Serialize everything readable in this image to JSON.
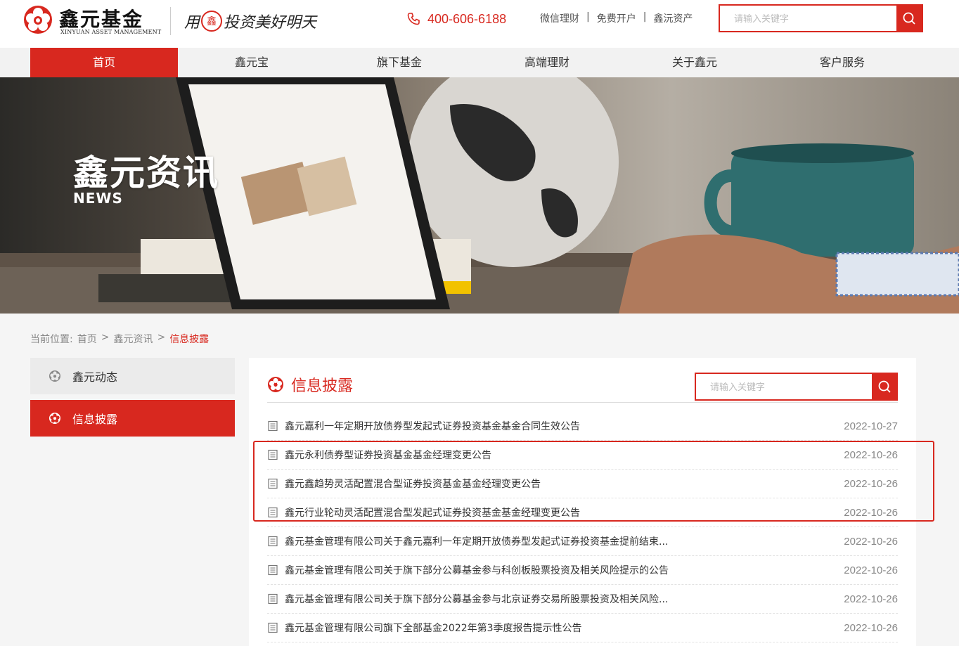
{
  "header": {
    "logo_cn": "鑫元基金",
    "logo_en": "XINYUAN ASSET MANAGEMENT",
    "slogan_pre": "用",
    "slogan_seal": "鑫",
    "slogan_post": "投资美好明天",
    "phone": "400-606-6188",
    "links": [
      "微信理财",
      "免费开户",
      "鑫沅资产"
    ],
    "link_sep": "|",
    "search_placeholder": "请输入关键字"
  },
  "nav": {
    "items": [
      "首页",
      "鑫元宝",
      "旗下基金",
      "高端理财",
      "关于鑫元",
      "客户服务"
    ],
    "active_index": 0
  },
  "banner": {
    "title": "鑫元资讯",
    "subtitle": "NEWS"
  },
  "breadcrumb": {
    "label": "当前位置:",
    "items": [
      "首页",
      "鑫元资讯",
      "信息披露"
    ],
    "sep": ">"
  },
  "sidebar": {
    "items": [
      "鑫元动态",
      "信息披露"
    ],
    "active_index": 1
  },
  "panel": {
    "title": "信息披露",
    "search_placeholder": "请输入关键字",
    "rows": [
      {
        "title": "鑫元嘉利一年定期开放债券型发起式证券投资基金基金合同生效公告",
        "date": "2022-10-27"
      },
      {
        "title": "鑫元永利债券型证券投资基金基金经理变更公告",
        "date": "2022-10-26"
      },
      {
        "title": "鑫元鑫趋势灵活配置混合型证券投资基金基金经理变更公告",
        "date": "2022-10-26"
      },
      {
        "title": "鑫元行业轮动灵活配置混合型发起式证券投资基金基金经理变更公告",
        "date": "2022-10-26"
      },
      {
        "title": "鑫元基金管理有限公司关于鑫元嘉利一年定期开放债券型发起式证券投资基金提前结束...",
        "date": "2022-10-26"
      },
      {
        "title": "鑫元基金管理有限公司关于旗下部分公募基金参与科创板股票投资及相关风险提示的公告",
        "date": "2022-10-26"
      },
      {
        "title": "鑫元基金管理有限公司关于旗下部分公募基金参与北京证券交易所股票投资及相关风险...",
        "date": "2022-10-26"
      },
      {
        "title": "鑫元基金管理有限公司旗下全部基金2022年第3季度报告提示性公告",
        "date": "2022-10-26"
      }
    ]
  },
  "colors": {
    "brand": "#d8281f"
  },
  "icons": {
    "phone": "phone-icon",
    "search": "search-icon",
    "logo": "flower-logo-icon",
    "doc": "document-icon"
  }
}
